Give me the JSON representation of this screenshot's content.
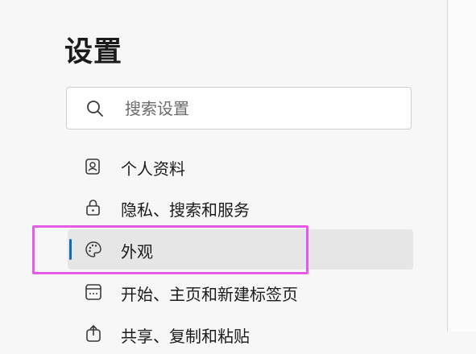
{
  "settings": {
    "title": "设置",
    "search": {
      "placeholder": "搜索设置",
      "value": ""
    },
    "nav_items": [
      {
        "label": "个人资料",
        "icon": "profile-icon"
      },
      {
        "label": "隐私、搜索和服务",
        "icon": "lock-icon"
      },
      {
        "label": "外观",
        "icon": "palette-icon",
        "selected": true
      },
      {
        "label": "开始、主页和新建标签页",
        "icon": "home-grid-icon"
      },
      {
        "label": "共享、复制和粘贴",
        "icon": "share-icon"
      }
    ]
  },
  "colors": {
    "accent": "#0f6cbd",
    "highlight_outline": "#e45ce6",
    "selected_bg": "#e6e6e6"
  }
}
